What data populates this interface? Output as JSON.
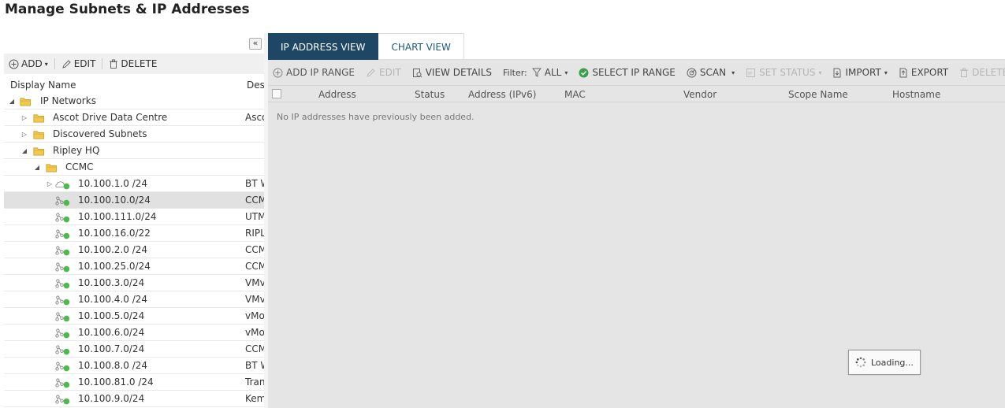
{
  "page": {
    "title": "Manage Subnets & IP Addresses"
  },
  "left": {
    "collapse_glyph": "«",
    "toolbar": {
      "add": "ADD",
      "edit": "EDIT",
      "delete": "DELETE"
    },
    "columns": {
      "display_name": "Display Name",
      "description": "Des"
    },
    "tree": [
      {
        "label": "IP Networks",
        "level": 0,
        "expander": "down",
        "icon": "folder-icon",
        "desc": ""
      },
      {
        "label": "Ascot Drive Data Centre",
        "level": 1,
        "expander": "right",
        "icon": "folder-icon",
        "desc": "Asco"
      },
      {
        "label": "Discovered Subnets",
        "level": 1,
        "expander": "right",
        "icon": "folder-icon",
        "desc": ""
      },
      {
        "label": "Ripley HQ",
        "level": 1,
        "expander": "down",
        "icon": "folder-icon",
        "desc": ""
      },
      {
        "label": "CCMC",
        "level": 2,
        "expander": "down",
        "icon": "folder-icon",
        "desc": ""
      },
      {
        "label": "10.100.1.0 /24",
        "level": 3,
        "expander": "right",
        "icon": "supernet-icon",
        "desc": "BT W"
      },
      {
        "label": "10.100.10.0/24",
        "level": 3,
        "expander": "",
        "icon": "subnet-icon",
        "desc": "CCM",
        "selected": true
      },
      {
        "label": "10.100.111.0/24",
        "level": 3,
        "expander": "",
        "icon": "subnet-icon",
        "desc": "UTM"
      },
      {
        "label": "10.100.16.0/22",
        "level": 3,
        "expander": "",
        "icon": "subnet-icon",
        "desc": "RIPL"
      },
      {
        "label": "10.100.2.0 /24",
        "level": 3,
        "expander": "",
        "icon": "subnet-icon",
        "desc": "CCM"
      },
      {
        "label": "10.100.25.0/24",
        "level": 3,
        "expander": "",
        "icon": "subnet-icon",
        "desc": "CCM"
      },
      {
        "label": "10.100.3.0/24",
        "level": 3,
        "expander": "",
        "icon": "subnet-icon",
        "desc": "VMv"
      },
      {
        "label": "10.100.4.0 /24",
        "level": 3,
        "expander": "",
        "icon": "subnet-icon",
        "desc": "VMv"
      },
      {
        "label": "10.100.5.0/24",
        "level": 3,
        "expander": "",
        "icon": "subnet-icon",
        "desc": "vMo"
      },
      {
        "label": "10.100.6.0/24",
        "level": 3,
        "expander": "",
        "icon": "subnet-icon",
        "desc": "vMo"
      },
      {
        "label": "10.100.7.0/24",
        "level": 3,
        "expander": "",
        "icon": "subnet-icon",
        "desc": "CCM"
      },
      {
        "label": "10.100.8.0 /24",
        "level": 3,
        "expander": "",
        "icon": "subnet-icon",
        "desc": "BT W"
      },
      {
        "label": "10.100.81.0 /24",
        "level": 3,
        "expander": "",
        "icon": "subnet-icon",
        "desc": "Tran"
      },
      {
        "label": "10.100.9.0/24",
        "level": 3,
        "expander": "",
        "icon": "subnet-icon",
        "desc": "Kem"
      }
    ]
  },
  "right": {
    "tabs": [
      {
        "label": "IP ADDRESS VIEW",
        "active": true
      },
      {
        "label": "CHART VIEW",
        "active": false
      }
    ],
    "toolbar": {
      "add_ip_range": "ADD IP RANGE",
      "edit": "EDIT",
      "view_details": "VIEW DETAILS",
      "filter_label": "Filter:",
      "filter_value": "ALL",
      "select_ip_range": "SELECT IP RANGE",
      "scan": "SCAN",
      "set_status": "SET STATUS",
      "import": "IMPORT",
      "export": "EXPORT",
      "delete": "DELETE"
    },
    "columns": [
      "Address",
      "Status",
      "Address (IPv6)",
      "MAC",
      "Vendor",
      "Scope Name",
      "Hostname"
    ],
    "empty_message": "No IP addresses have previously been added.",
    "loading_text": "Loading..."
  },
  "colors": {
    "active_tab": "#1e4766",
    "status_up": "#4cbb4c",
    "folder": "#f2c94c",
    "select_check": "#3ca04a"
  }
}
